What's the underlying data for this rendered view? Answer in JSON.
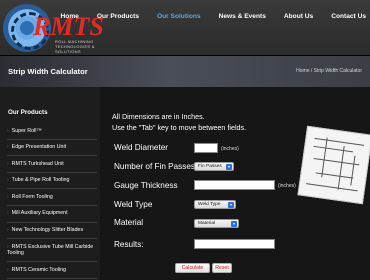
{
  "logo": {
    "text": "RMTS",
    "subtitle": "ROLL MACHINING TECHNOLOGIES & SOLUTIONS"
  },
  "nav": [
    {
      "label": "Home",
      "active": false
    },
    {
      "label": "Our Products",
      "active": false
    },
    {
      "label": "Our Solutions",
      "active": true
    },
    {
      "label": "News & Events",
      "active": false
    },
    {
      "label": "About Us",
      "active": false
    },
    {
      "label": "Contact Us",
      "active": false
    }
  ],
  "titlebar": {
    "title": "Strip Width Calculator",
    "breadcrumb": "Home / Strip Width Calculator"
  },
  "sidebar": {
    "heading": "Our Products",
    "items": [
      "Super Roll™",
      "Edge Presentation Unit",
      "RMTS Turkshead Unit",
      "Tube & Pipe Roll Tooling",
      "Roll Form Tooling",
      "Mill Auxiliary Equipment",
      "New Technology Slitter Blades",
      "RMTS Exclusive Tube Mill Carbide Tooling",
      "RMTS Ceramic Tooling"
    ]
  },
  "form": {
    "intro_line1": "All Dimensions are in Inches.",
    "intro_line2": "Use the \"Tab\" key to move between fields.",
    "weld_diameter_label": "Weld Diameter",
    "weld_diameter_value": "",
    "weld_diameter_unit": "(inches)",
    "fin_passes_label": "Number of Fin Passes",
    "fin_passes_selected": "Fin Passes",
    "gauge_label": "Gauge Thickness",
    "gauge_value": "",
    "gauge_unit": "(inches)",
    "weld_type_label": "Weld Type",
    "weld_type_selected": "Weld Type",
    "material_label": "Material",
    "material_selected": "Material",
    "results_label": "Results:",
    "results_value": "",
    "calculate_label": "Calculate",
    "reset_label": "Reset"
  },
  "colors": {
    "accent_blue": "#5aa6e3",
    "brand_red": "#e32b25"
  }
}
